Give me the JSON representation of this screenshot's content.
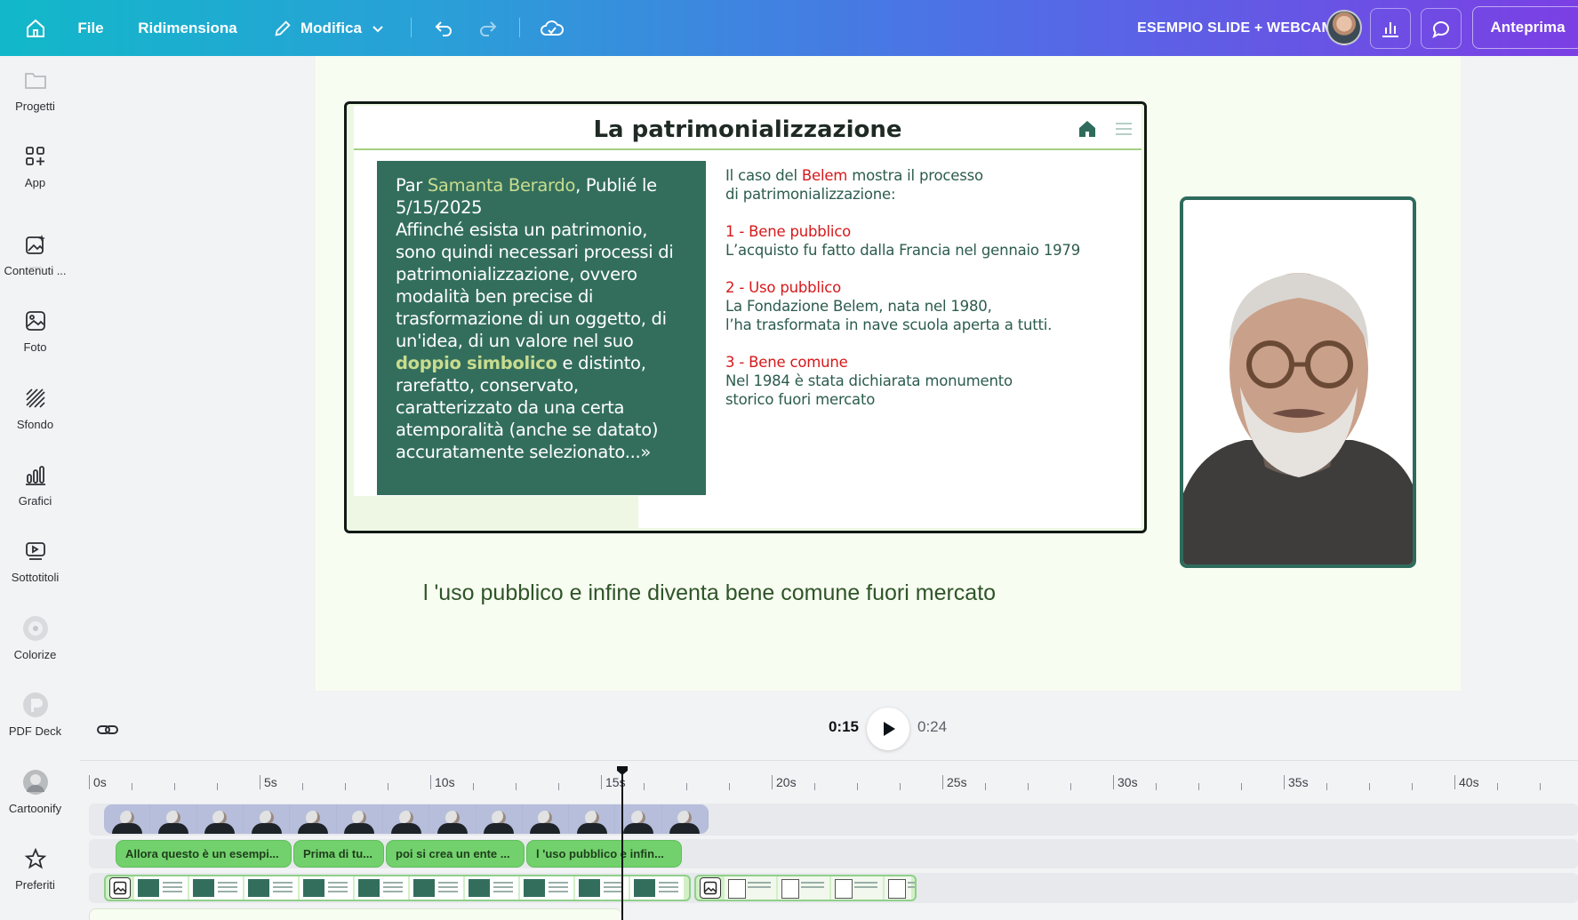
{
  "topbar": {
    "file_label": "File",
    "resize_label": "Ridimensiona",
    "edit_label": "Modifica",
    "doc_title": "ESEMPIO SLIDE + WEBCAM",
    "preview_label": "Anteprima"
  },
  "sidebar": {
    "items": [
      {
        "label": "Progetti",
        "icon": "folder-icon"
      },
      {
        "label": "App",
        "icon": "apps-grid-icon"
      },
      {
        "label": "Contenuti ...",
        "icon": "magic-image-icon"
      },
      {
        "label": "Foto",
        "icon": "photo-icon"
      },
      {
        "label": "Sfondo",
        "icon": "background-pattern-icon"
      },
      {
        "label": "Grafici",
        "icon": "bar-chart-icon"
      },
      {
        "label": "Sottotitoli",
        "icon": "captions-icon"
      },
      {
        "label": "Colorize",
        "icon": "colorize-app-icon"
      },
      {
        "label": "PDF Deck",
        "icon": "pdf-deck-app-icon"
      },
      {
        "label": "Cartoonify",
        "icon": "cartoonify-app-icon"
      },
      {
        "label": "Preferiti",
        "icon": "star-icon"
      }
    ]
  },
  "slide": {
    "title": "La patrimonializzazione",
    "quote": {
      "prefix": "Par ",
      "author": "Samanta Berardo",
      "date_text": ", Publié le 5/15/2025",
      "body1": "Affinché esista un patrimonio, sono quindi necessari processi di patrimonializzazione, ovvero modalità ben precise di trasformazione di un oggetto, di un'idea, di un valore nel suo ",
      "highlight": "doppio simbolico",
      "body2": " e distinto, rarefatto, conservato, caratterizzato da una certa atemporalità (anche se datato) accuratamente selezionato...»"
    },
    "intro_pre": "Il caso del ",
    "intro_red": "Belem",
    "intro_post": " mostra il processo",
    "intro_line2": "di patrimonializzazione:",
    "points": [
      {
        "title": "1 - Bene pubblico",
        "lines": [
          "L’acquisto fu fatto dalla Francia nel gennaio 1979"
        ]
      },
      {
        "title": "2 - Uso pubblico",
        "lines": [
          "La Fondazione Belem, nata nel 1980,",
          "l’ha trasformata in nave scuola aperta a tutti."
        ]
      },
      {
        "title": "3 - Bene comune",
        "lines": [
          "Nel 1984 è stata dichiarata monumento",
          "storico fuori mercato"
        ]
      }
    ]
  },
  "subtitle_text": "l 'uso pubblico e infine diventa bene comune fuori mercato",
  "player": {
    "current_time": "0:15",
    "total_time": "0:24"
  },
  "ruler_labels": [
    "0s",
    "5s",
    "10s",
    "15s",
    "20s",
    "25s",
    "30s",
    "35s",
    "40s"
  ],
  "caption_clips": [
    {
      "label": "Allora questo è un esempi..."
    },
    {
      "label": "Prima di tu..."
    },
    {
      "label": "poi si crea un ente ..."
    },
    {
      "label": "l 'uso pubblico e infin..."
    }
  ],
  "colors": {
    "accent_green": "#336e5d",
    "highlight_red": "#d6191b",
    "caption_green": "#72d16d"
  }
}
